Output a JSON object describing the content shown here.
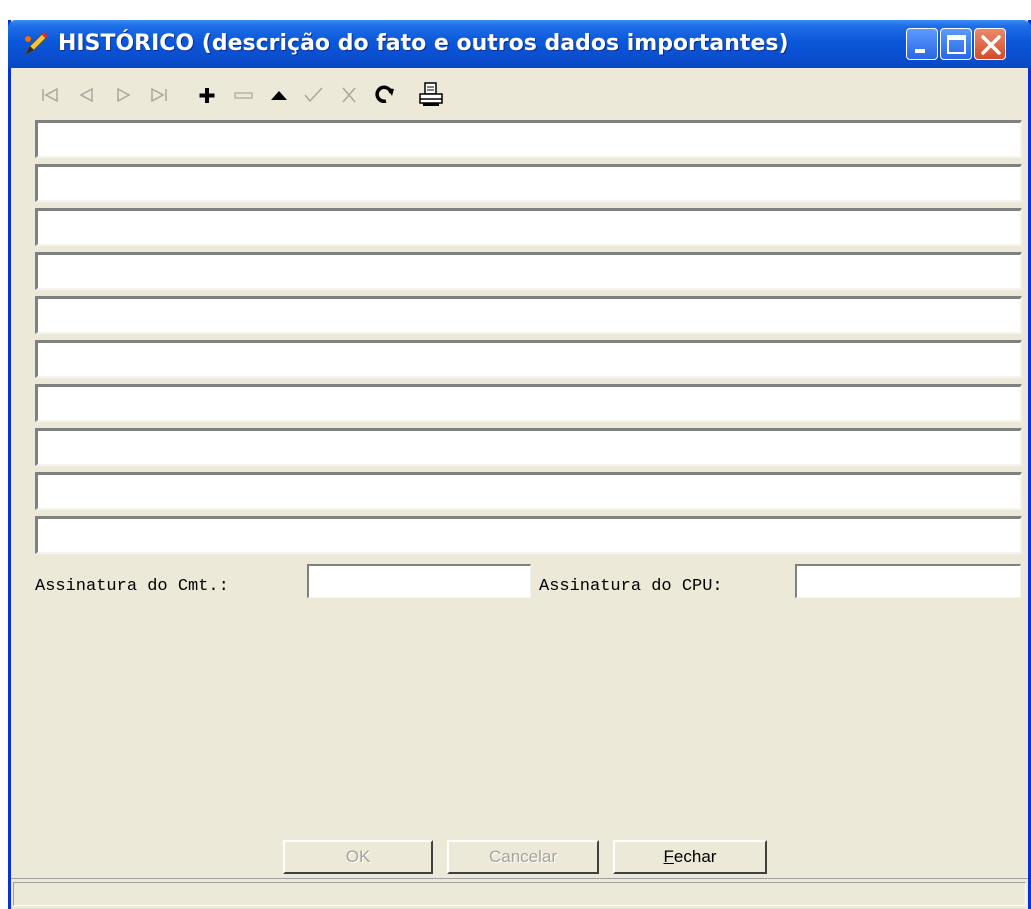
{
  "window": {
    "title": "HISTÓRICO (descrição do fato e outros dados importantes)"
  },
  "toolbar": {
    "items": [
      {
        "name": "first-record-icon",
        "enabled": false
      },
      {
        "name": "prior-record-icon",
        "enabled": false
      },
      {
        "name": "next-record-icon",
        "enabled": false
      },
      {
        "name": "last-record-icon",
        "enabled": false
      },
      {
        "name": "insert-record-icon",
        "enabled": true
      },
      {
        "name": "delete-record-icon",
        "enabled": false
      },
      {
        "name": "edit-record-icon",
        "enabled": true
      },
      {
        "name": "post-edit-icon",
        "enabled": false
      },
      {
        "name": "cancel-edit-icon",
        "enabled": false
      },
      {
        "name": "refresh-icon",
        "enabled": true
      },
      {
        "name": "print-icon",
        "enabled": true
      }
    ]
  },
  "history_lines": [
    "",
    "",
    "",
    "",
    "",
    "",
    "",
    "",
    "",
    ""
  ],
  "signatures": {
    "cmt_label": "Assinatura do Cmt.:",
    "cmt_value": "",
    "cpu_label": "Assinatura do CPU:",
    "cpu_value": ""
  },
  "buttons": {
    "ok": "OK",
    "cancel": "Cancelar",
    "close_accel": "F",
    "close_rest": "echar"
  },
  "colors": {
    "title_bar": "#0a4fd0",
    "face": "#ece9d8",
    "close_button": "#d44b26"
  }
}
